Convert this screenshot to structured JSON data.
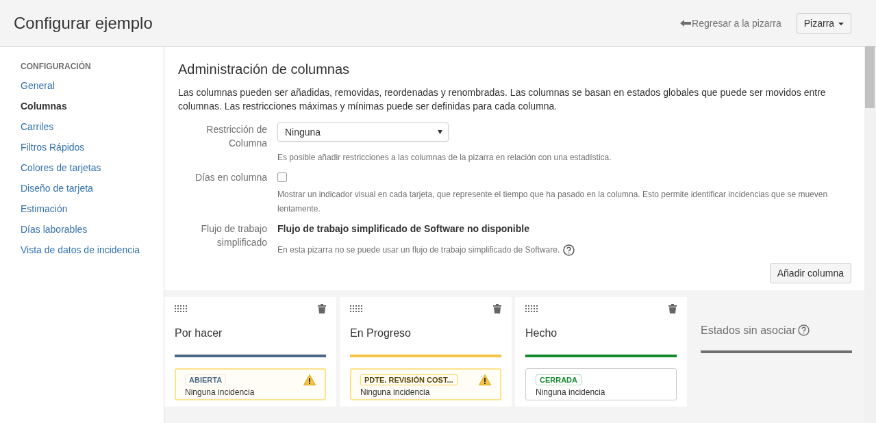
{
  "header": {
    "title": "Configurar ejemplo",
    "back_link": "Regresar a la pizarra",
    "board_menu": "Pizarra"
  },
  "sidebar": {
    "heading": "CONFIGURACIÓN",
    "items": [
      {
        "label": "General",
        "selected": false
      },
      {
        "label": "Columnas",
        "selected": true
      },
      {
        "label": "Carriles",
        "selected": false
      },
      {
        "label": "Filtros Rápidos",
        "selected": false
      },
      {
        "label": "Colores de tarjetas",
        "selected": false
      },
      {
        "label": "Diseño de tarjeta",
        "selected": false
      },
      {
        "label": "Estimación",
        "selected": false
      },
      {
        "label": "Días laborables",
        "selected": false
      },
      {
        "label": "Vista de datos de incidencia",
        "selected": false
      }
    ]
  },
  "main": {
    "title": "Administración de columnas",
    "description": "Las columnas pueden ser añadidas, removidas, reordenadas y renombradas. Las columnas se basan en estados globales que puede ser movidos entre columnas. Las restricciones máximas y mínimas puede ser definidas para cada columna.",
    "constraint": {
      "label": "Restricción de Columna",
      "value": "Ninguna",
      "help": "Es posible añadir restricciones a las columnas de la pizarra en relación con una estadística."
    },
    "days_in_column": {
      "label": "Días en columna",
      "checked": false,
      "help": "Mostrar un indicador visual en cada tarjeta, que represente el tiempo que ha pasado en la columna. Esto permite identificar incidencias que se mueven lentamente."
    },
    "simplified_workflow": {
      "label": "Flujo de trabajo simplificado",
      "value": "Flujo de trabajo simplificado de Software no disponible",
      "help": "En esta pizarra no se puede usar un flujo de trabajo simplificado de Software."
    },
    "add_button": "Añadir columna"
  },
  "columns": [
    {
      "name": "Por hacer",
      "color": "#4a6785",
      "status": {
        "label": "ABIERTA",
        "kind": "todo",
        "warning": true,
        "issues": "Ninguna incidencia"
      }
    },
    {
      "name": "En Progreso",
      "color": "#f6c342",
      "status": {
        "label": "PDTE. REVISIÓN COST...",
        "kind": "progress",
        "warning": true,
        "issues": "Ninguna incidencia"
      }
    },
    {
      "name": "Hecho",
      "color": "#14892c",
      "status": {
        "label": "CERRADA",
        "kind": "done",
        "warning": false,
        "issues": "Ninguna incidencia"
      }
    }
  ],
  "unmapped": {
    "title": "Estados sin asociar"
  }
}
